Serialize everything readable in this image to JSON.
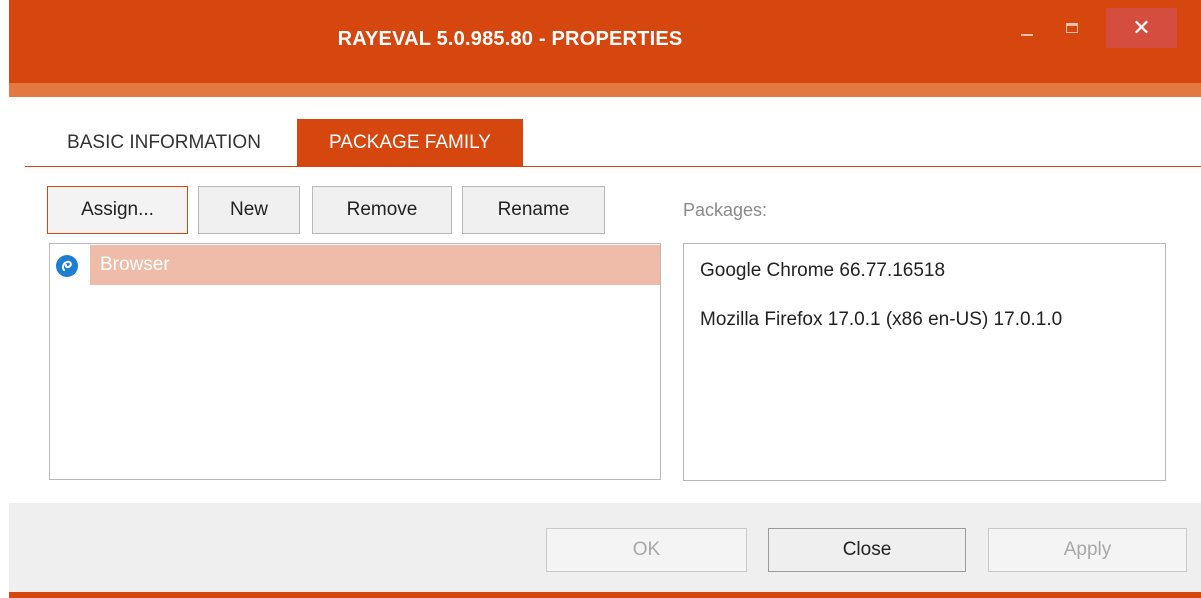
{
  "window": {
    "title": "RAYEVAL 5.0.985.80 - PROPERTIES",
    "accent_color": "#d6460f",
    "controls": {
      "minimize": "minimize-icon",
      "maximize": "maximize-icon",
      "close_glyph": "✕"
    }
  },
  "tabs": [
    {
      "label": "BASIC INFORMATION",
      "selected": false
    },
    {
      "label": "PACKAGE FAMILY",
      "selected": true
    }
  ],
  "toolbar": {
    "assign_label": "Assign...",
    "new_label": "New",
    "remove_label": "Remove",
    "rename_label": "Rename"
  },
  "family_list": {
    "items": [
      {
        "label": "Browser",
        "icon": "browser-family-icon",
        "selected": true
      }
    ]
  },
  "packages": {
    "label": "Packages:",
    "items": [
      {
        "label": "Google Chrome 66.77.16518"
      },
      {
        "label": "Mozilla Firefox 17.0.1 (x86 en-US) 17.0.1.0"
      }
    ]
  },
  "footer": {
    "ok_label": "OK",
    "close_label": "Close",
    "apply_label": "Apply"
  }
}
